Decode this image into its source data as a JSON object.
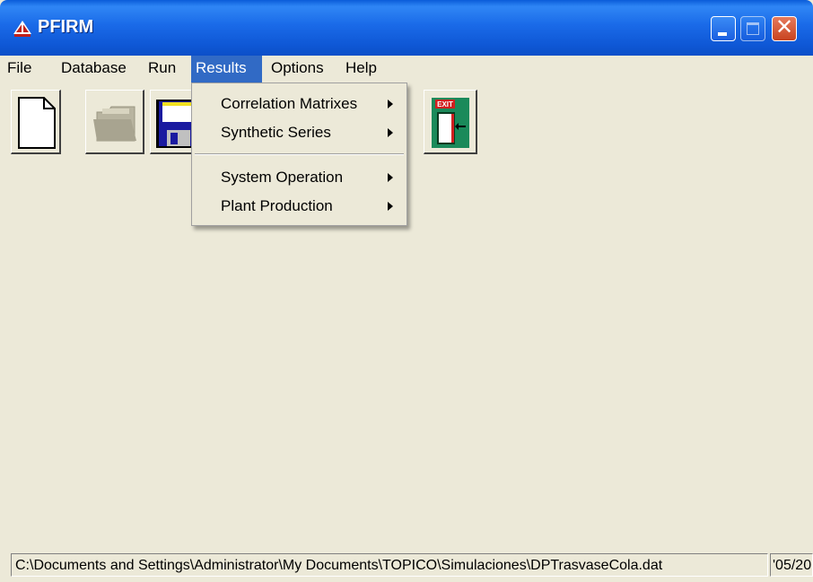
{
  "window": {
    "title": "PFIRM",
    "controls": [
      "minimize",
      "maximize",
      "close"
    ],
    "close_glyph": "✕"
  },
  "menubar": {
    "items": [
      {
        "label": "File"
      },
      {
        "label": "Database"
      },
      {
        "label": "Run"
      },
      {
        "label": "Results",
        "active": true
      },
      {
        "label": "Options"
      },
      {
        "label": "Help"
      }
    ]
  },
  "toolbar": {
    "buttons": [
      {
        "name": "new-file-button",
        "icon": "blank-page-icon"
      },
      {
        "name": "open-folder-button",
        "icon": "folder-icon",
        "disabled": true
      },
      {
        "name": "save-button",
        "icon": "floppy-disk-icon"
      },
      {
        "name": "exit-button",
        "icon": "exit-door-icon",
        "icon_text": "EXIT"
      }
    ]
  },
  "results_menu": {
    "items": [
      {
        "label": "Correlation Matrixes",
        "submenu": true
      },
      {
        "label": "Synthetic Series",
        "submenu": true
      },
      {
        "label": "System Operation",
        "submenu": true
      },
      {
        "label": "Plant Production",
        "submenu": true
      }
    ]
  },
  "statusbar": {
    "path": "C:\\Documents and Settings\\Administrator\\My Documents\\TOPICO\\Simulaciones\\DPTrasvaseCola.dat",
    "date_fragment": "'05/20"
  },
  "colors": {
    "titlebar": "#1a6ae8",
    "menu_highlight": "#316ac5",
    "face": "#ece9d8",
    "close_button": "#c8431f"
  }
}
